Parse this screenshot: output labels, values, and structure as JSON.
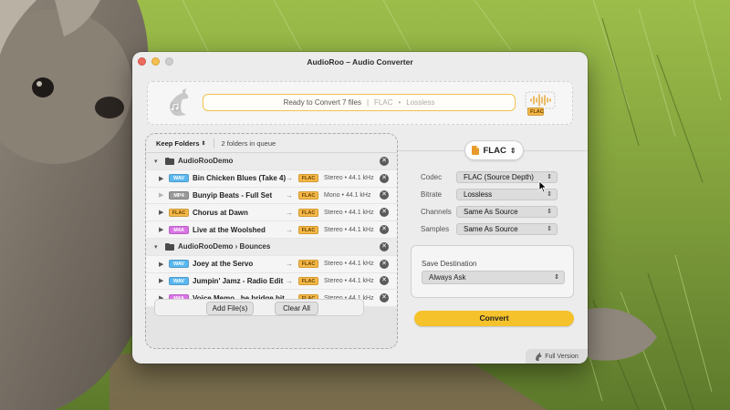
{
  "window": {
    "title": "AudioRoo – Audio Converter"
  },
  "header": {
    "status_text": "Ready to Convert 7 files",
    "status_separator": "|",
    "status_format": "FLAC",
    "status_dot": "•",
    "status_quality": "Lossless",
    "art_badge": "FLAC"
  },
  "file_panel": {
    "keep_folders_label": "Keep Folders",
    "queue_count": "2 folders in queue",
    "groups": [
      {
        "folder": "AudioRooDemo",
        "files": [
          {
            "src": "WAV",
            "name": "Bin Chicken Blues (Take 4)",
            "dst": "FLAC",
            "meta": "Stereo • 44.1 kHz",
            "playable": true
          },
          {
            "src": "MP4",
            "name": "Bunyip Beats - Full Set",
            "dst": "FLAC",
            "meta": "Mono • 44.1 kHz",
            "playable": false
          },
          {
            "src": "FLAC",
            "name": "Chorus at Dawn",
            "dst": "FLAC",
            "meta": "Stereo • 44.1 kHz",
            "playable": true
          },
          {
            "src": "M4A",
            "name": "Live at the Woolshed",
            "dst": "FLAC",
            "meta": "Stereo • 44.1 kHz",
            "playable": true
          }
        ]
      },
      {
        "folder": "AudioRooDemo › Bounces",
        "files": [
          {
            "src": "WAV",
            "name": "Joey at the Servo",
            "dst": "FLAC",
            "meta": "Stereo • 44.1 kHz",
            "playable": true
          },
          {
            "src": "WAV",
            "name": "Jumpin' Jamz - Radio Edit",
            "dst": "FLAC",
            "meta": "Stereo • 44.1 kHz",
            "playable": true
          },
          {
            "src": "M4A",
            "name": "Voice Memo...he bridge bit",
            "dst": "FLAC",
            "meta": "Stereo • 44.1 kHz",
            "playable": true
          }
        ]
      }
    ],
    "add_files_label": "Add File(s)",
    "clear_all_label": "Clear All"
  },
  "format": {
    "selected": "FLAC"
  },
  "settings": {
    "codec_label": "Codec",
    "codec_value": "FLAC (Source Depth)",
    "bitrate_label": "Bitrate",
    "bitrate_value": "Lossless",
    "channels_label": "Channels",
    "channels_value": "Same As Source",
    "samples_label": "Samples",
    "samples_value": "Same As Source"
  },
  "destination": {
    "label": "Save Destination",
    "value": "Always Ask"
  },
  "convert_label": "Convert",
  "full_version_label": "Full Version",
  "colors": {
    "accent": "#f6c22b",
    "wav_badge": "#5bb8ef",
    "mp4_badge": "#9a9a9a",
    "flac_badge": "#f3b849",
    "m4a_badge": "#d974e6"
  }
}
